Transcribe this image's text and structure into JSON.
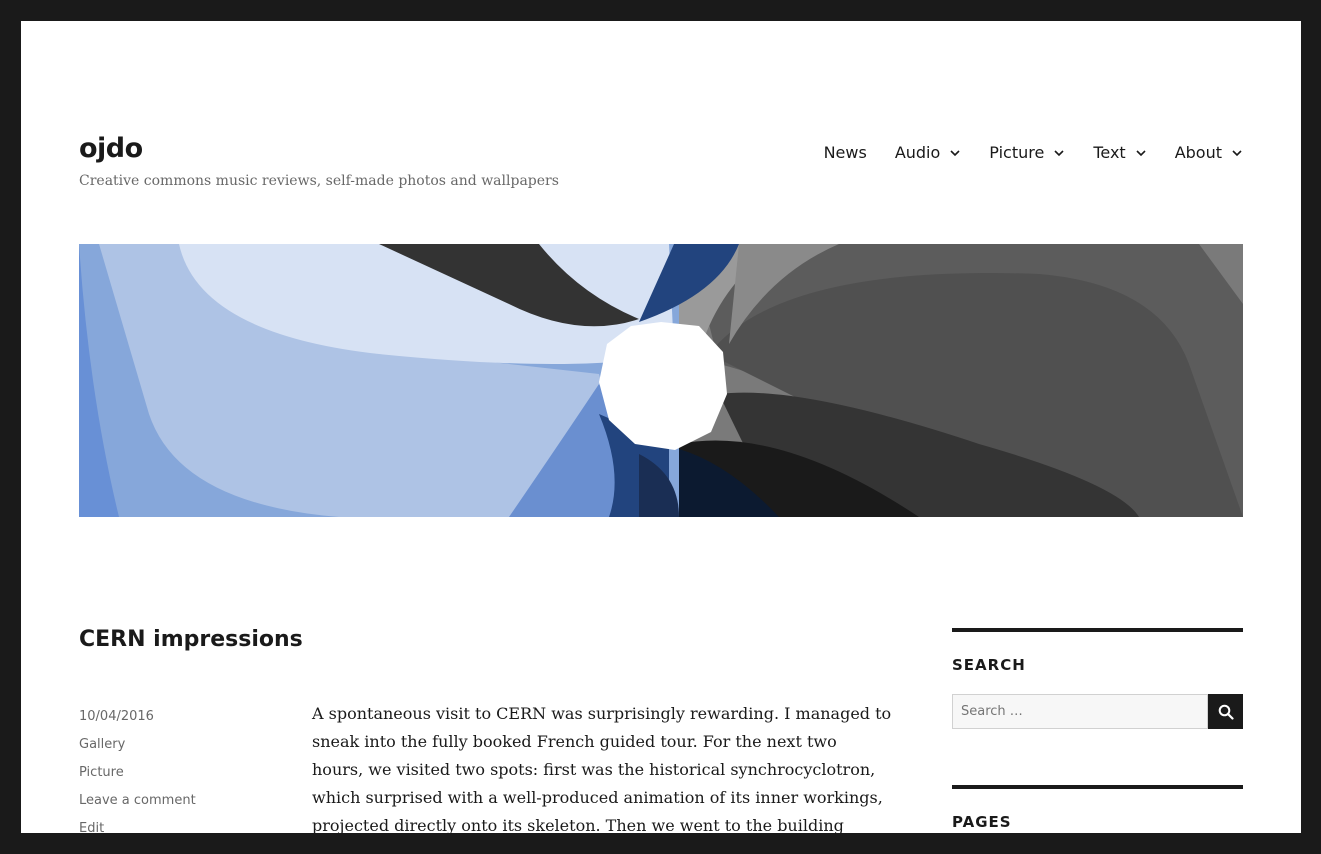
{
  "site": {
    "title": "ojdo",
    "description": "Creative commons music reviews, self-made photos and wallpapers"
  },
  "nav": {
    "items": [
      {
        "label": "News",
        "has_submenu": false
      },
      {
        "label": "Audio",
        "has_submenu": true
      },
      {
        "label": "Picture",
        "has_submenu": true
      },
      {
        "label": "Text",
        "has_submenu": true
      },
      {
        "label": "About",
        "has_submenu": true
      }
    ]
  },
  "post": {
    "title": "CERN impressions",
    "date": "10/04/2016",
    "format": "Gallery",
    "category": "Picture",
    "comment_link": "Leave a comment",
    "edit_link": "Edit",
    "body": "A spontaneous visit to CERN was surprisingly rewarding. I managed to sneak into the fully booked French guided tour. For the next two hours, we visited two spots: first was the historical synchrocyclotron, which surprised with a well-produced animation of its inner workings, projected directly onto its skeleton. Then we went to the building above"
  },
  "sidebar": {
    "search": {
      "title": "SEARCH",
      "placeholder": "Search …"
    },
    "pages": {
      "title": "PAGES"
    }
  },
  "colors": {
    "text": "#1a1a1a",
    "meta": "#686868",
    "frame": "#1a1a1a"
  },
  "icons": {
    "search_button": "search-icon",
    "submenu": "chevron-down-icon"
  }
}
